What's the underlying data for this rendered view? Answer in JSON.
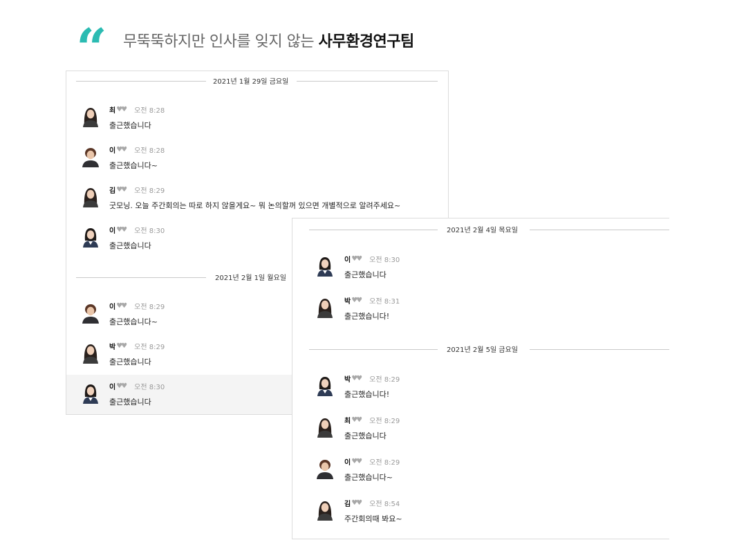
{
  "headline": {
    "quote": "“",
    "normal": "무뚝뚝하지만 인사를 잊지 않는 ",
    "bold": "사무환경연구팀"
  },
  "colors": {
    "accent": "#2bbbb2",
    "hearts": "#a8a8a8",
    "time": "#999999",
    "divider": "#c9c9c9",
    "highlight": "#f4f4f4"
  },
  "panel_a": {
    "days": [
      "2021년 1월 29일 금요일",
      "2021년 2월 1일 월요일"
    ],
    "messages": [
      {
        "name": "최",
        "hearts": "♥♥",
        "time": "오전 8:28",
        "text": "출근했습니다",
        "avatar": "avatar-woman-long-hair"
      },
      {
        "name": "이",
        "hearts": "♥♥",
        "time": "오전 8:28",
        "text": "출근했습니다~",
        "avatar": "avatar-woman-short-hair"
      },
      {
        "name": "김",
        "hearts": "♥♥",
        "time": "오전 8:29",
        "text": "굿모닝. 오늘 주간회의는 따로 하지 않을게요~ 뭐 논의할꺼 있으면 개별적으로 알려주세요~",
        "avatar": "avatar-woman-long-hair"
      },
      {
        "name": "이",
        "hearts": "♥♥",
        "time": "오전 8:30",
        "text": "출근했습니다",
        "avatar": "avatar-woman-bob"
      },
      {
        "name": "이",
        "hearts": "♥♥",
        "time": "오전 8:29",
        "text": "출근했습니다~",
        "avatar": "avatar-woman-short-hair"
      },
      {
        "name": "박",
        "hearts": "♥♥",
        "time": "오전 8:29",
        "text": "출근했습니다",
        "avatar": "avatar-woman-long-hair"
      },
      {
        "name": "이",
        "hearts": "♥♥",
        "time": "오전 8:30",
        "text": "출근했습니다",
        "avatar": "avatar-woman-bob"
      }
    ]
  },
  "panel_b": {
    "days": [
      "2021년 2월 4일 목요일",
      "2021년 2월 5일 금요일"
    ],
    "messages": [
      {
        "name": "이",
        "hearts": "♥♥",
        "time": "오전 8:30",
        "text": "출근했습니다",
        "avatar": "avatar-woman-bob"
      },
      {
        "name": "박",
        "hearts": "♥♥",
        "time": "오전 8:31",
        "text": "출근했습니다!",
        "avatar": "avatar-woman-long-hair"
      },
      {
        "name": "박",
        "hearts": "♥♥",
        "time": "오전 8:29",
        "text": "출근했습니다!",
        "avatar": "avatar-woman-bob"
      },
      {
        "name": "최",
        "hearts": "♥♥",
        "time": "오전 8:29",
        "text": "출근했습니다",
        "avatar": "avatar-woman-long-hair"
      },
      {
        "name": "이",
        "hearts": "♥♥",
        "time": "오전 8:29",
        "text": "출근했습니다~",
        "avatar": "avatar-woman-short-hair"
      },
      {
        "name": "김",
        "hearts": "♥♥",
        "time": "오전 8:54",
        "text": "주간회의때 봐요~",
        "avatar": "avatar-woman-long-hair"
      }
    ]
  }
}
